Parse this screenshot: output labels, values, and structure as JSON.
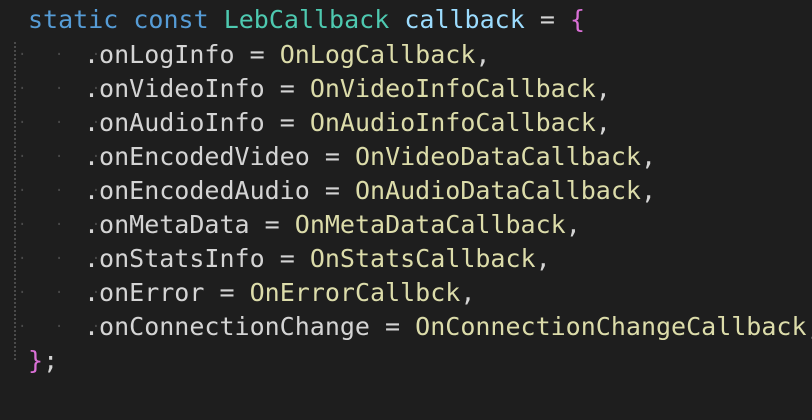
{
  "code": {
    "line1": {
      "kw_static": "static",
      "kw_const": "const",
      "type": "LebCallback",
      "var": "callback",
      "op": "=",
      "open": "{"
    },
    "members": [
      {
        "field": ".onLogInfo",
        "op": "=",
        "value": "OnLogCallback",
        "punct": ","
      },
      {
        "field": ".onVideoInfo",
        "op": "=",
        "value": "OnVideoInfoCallback",
        "punct": ","
      },
      {
        "field": ".onAudioInfo",
        "op": "=",
        "value": "OnAudioInfoCallback",
        "punct": ","
      },
      {
        "field": ".onEncodedVideo",
        "op": "=",
        "value": "OnVideoDataCallback",
        "punct": ","
      },
      {
        "field": ".onEncodedAudio",
        "op": "=",
        "value": "OnAudioDataCallback",
        "punct": ","
      },
      {
        "field": ".onMetaData",
        "op": "=",
        "value": "OnMetaDataCallback",
        "punct": ","
      },
      {
        "field": ".onStatsInfo",
        "op": "=",
        "value": "OnStatsCallback",
        "punct": ","
      },
      {
        "field": ".onError",
        "op": "=",
        "value": "OnErrorCallbck",
        "punct": ","
      },
      {
        "field": ".onConnectionChange",
        "op": "=",
        "value": "OnConnectionChangeCallback",
        "punct": ","
      }
    ],
    "closing": {
      "close": "}",
      "semi": ";"
    },
    "whitespace_dots": "· · · ·"
  },
  "colors": {
    "background": "#1e1e1e",
    "keyword": "#569cd6",
    "type": "#4ec9b0",
    "variable": "#9cdcfe",
    "function": "#dcdcaa",
    "brace": "#ffd700",
    "operator": "#d4d4d4"
  }
}
